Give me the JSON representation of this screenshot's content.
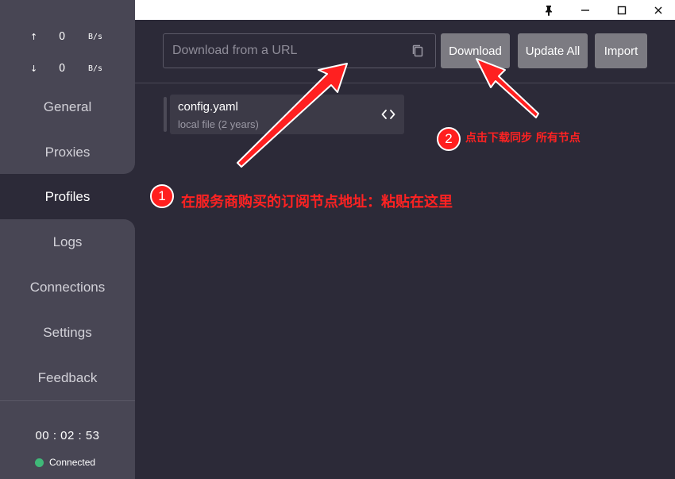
{
  "titlebar": {
    "pin_icon": "pin-icon",
    "min_icon": "minimize-icon",
    "max_icon": "maximize-icon",
    "close_icon": "close-icon"
  },
  "sidebar": {
    "upload": {
      "arrow": "↑",
      "value": "0",
      "unit": "B/s"
    },
    "download": {
      "arrow": "↓",
      "value": "0",
      "unit": "B/s"
    },
    "items": [
      {
        "label": "General"
      },
      {
        "label": "Proxies"
      },
      {
        "label": "Profiles",
        "active": true
      },
      {
        "label": "Logs"
      },
      {
        "label": "Connections"
      },
      {
        "label": "Settings"
      },
      {
        "label": "Feedback"
      }
    ],
    "timer": "00 : 02 : 53",
    "status": {
      "label": "Connected",
      "color": "#3fb878"
    }
  },
  "main": {
    "url_input": {
      "value": "",
      "placeholder": "Download from a URL"
    },
    "buttons": {
      "download": "Download",
      "update_all": "Update All",
      "import": "Import"
    },
    "profiles": [
      {
        "name": "config.yaml",
        "sub": "local file (2 years)"
      }
    ]
  },
  "annotations": {
    "step1": {
      "number": "1",
      "text": "在服务商购买的订阅节点地址：粘贴在这里"
    },
    "step2": {
      "number": "2",
      "text": "点击下载同步 所有节点"
    },
    "color": "#ff1e1e"
  },
  "colors": {
    "background": "#2c2a38",
    "sidebar": "#484654",
    "button": "#7c7b82",
    "card": "#3c3a47"
  }
}
